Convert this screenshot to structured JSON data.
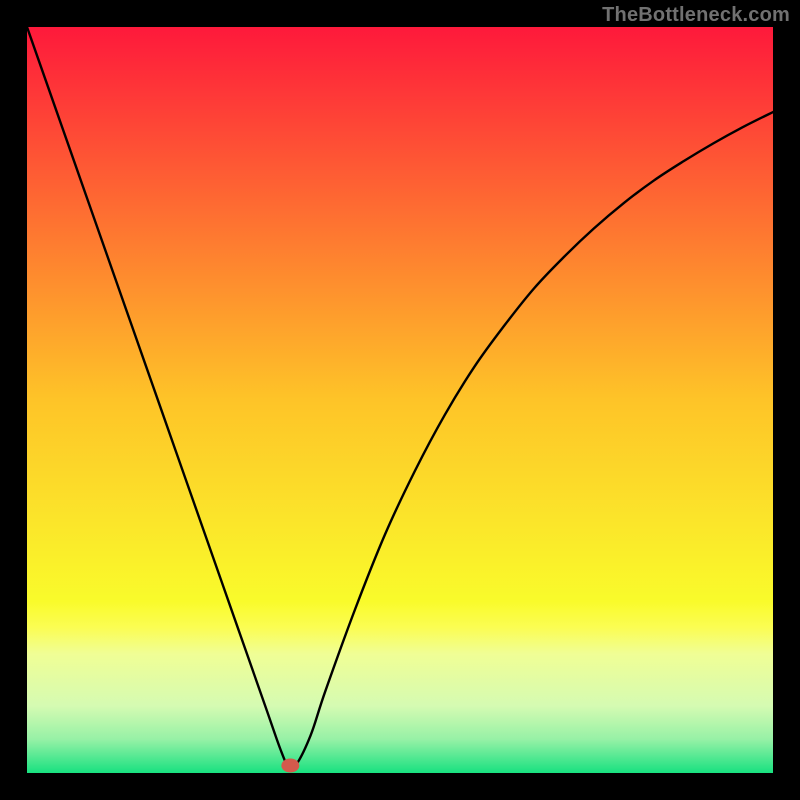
{
  "attribution": "TheBottleneck.com",
  "chart_data": {
    "type": "line",
    "title": "",
    "xlabel": "",
    "ylabel": "",
    "xlim": [
      0,
      100
    ],
    "ylim": [
      0,
      100
    ],
    "x": [
      0,
      4,
      8,
      12,
      16,
      20,
      24,
      28,
      32,
      34,
      35,
      36,
      38,
      40,
      44,
      48,
      52,
      56,
      60,
      64,
      68,
      72,
      76,
      80,
      84,
      88,
      92,
      96,
      100
    ],
    "values": [
      100,
      88.6,
      77.2,
      65.8,
      54.4,
      43.0,
      31.6,
      20.2,
      8.8,
      3.1,
      1.0,
      1.0,
      5.0,
      11.0,
      22.0,
      32.0,
      40.5,
      48.0,
      54.5,
      60.0,
      65.0,
      69.2,
      73.0,
      76.4,
      79.4,
      82.0,
      84.4,
      86.6,
      88.6
    ],
    "marker": {
      "x": 35.3,
      "y": 1.0,
      "color": "#d45a4c"
    },
    "background_gradient": {
      "top": "#fe193b",
      "mid_upper": "#fec428",
      "mid_lower": "#f9fb2b",
      "band": "#f0fe95",
      "bottom": "#18e180"
    }
  }
}
